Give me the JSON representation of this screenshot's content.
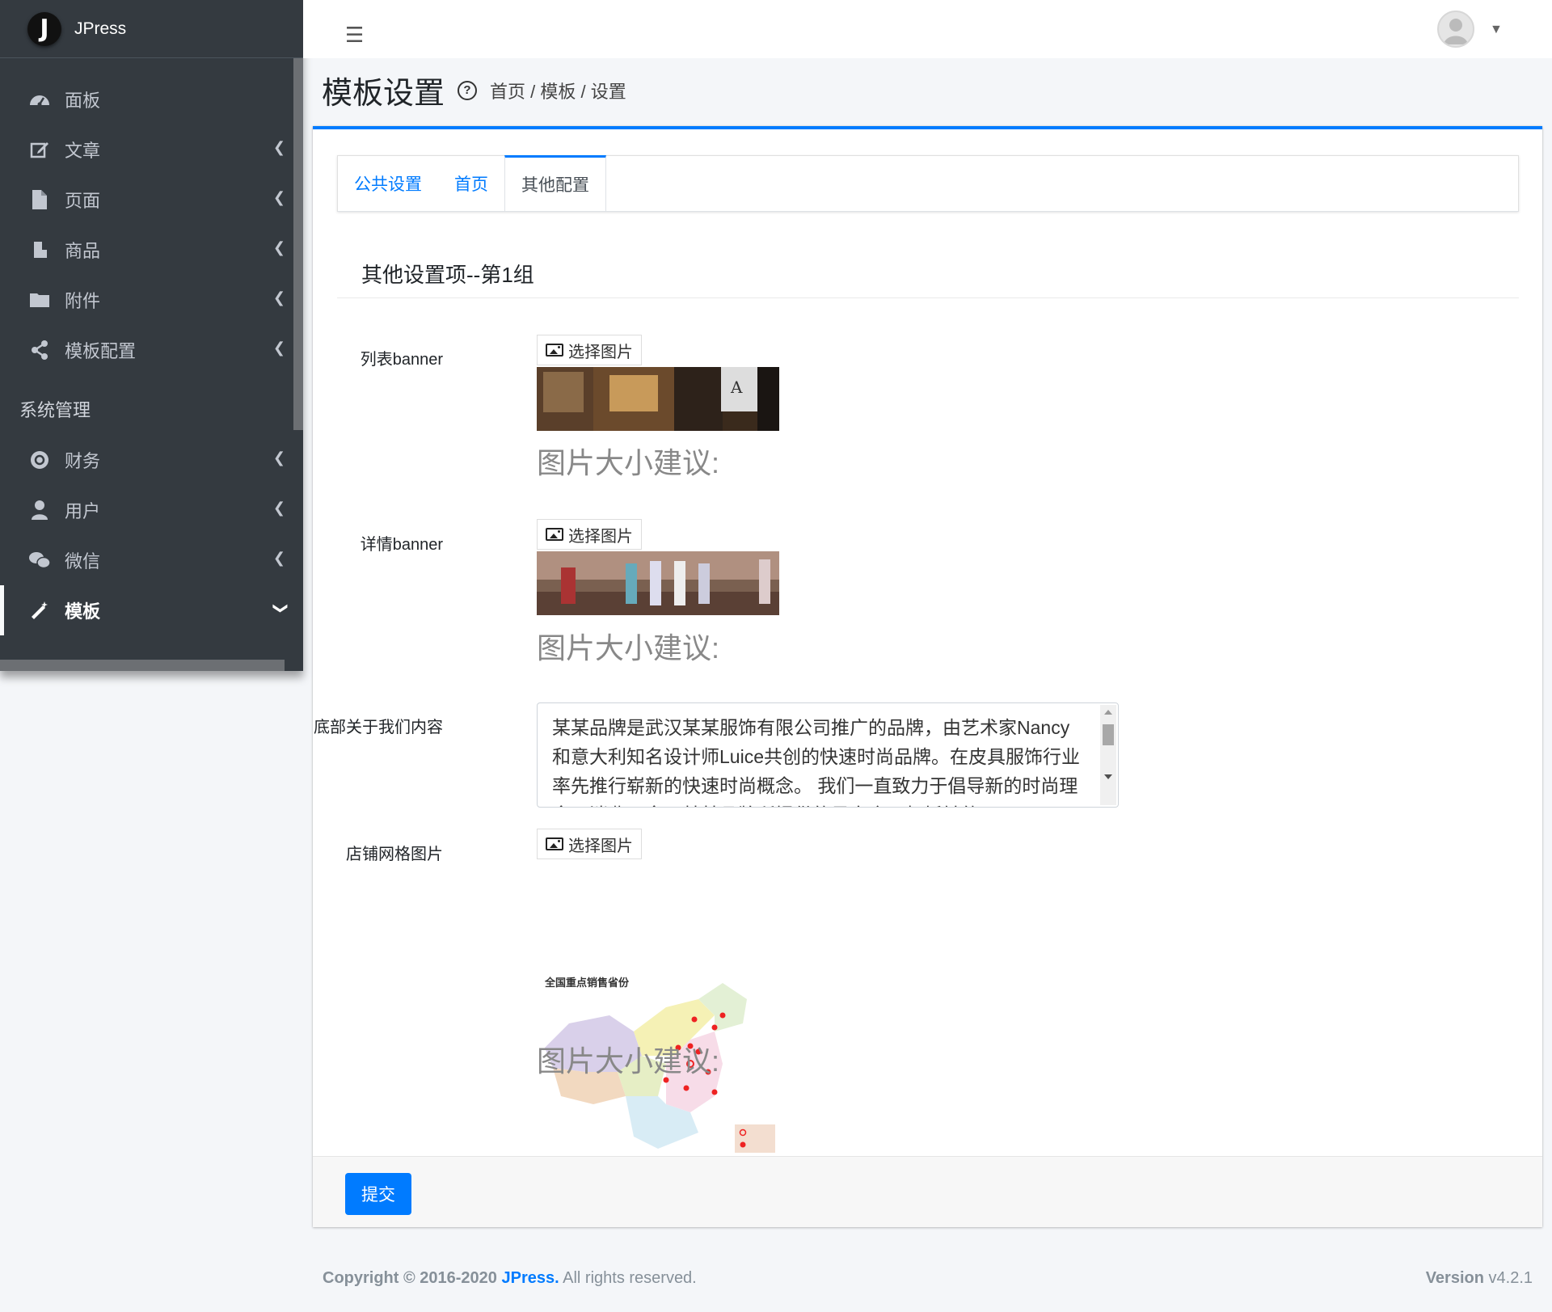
{
  "brand": {
    "logo_letter": "J",
    "name": "JPress"
  },
  "sidebar": {
    "items": [
      {
        "label": "面板",
        "icon": "dashboard-icon",
        "has_children": false
      },
      {
        "label": "文章",
        "icon": "edit-icon",
        "has_children": true
      },
      {
        "label": "页面",
        "icon": "file-icon",
        "has_children": true
      },
      {
        "label": "商品",
        "icon": "product-icon",
        "has_children": true
      },
      {
        "label": "附件",
        "icon": "folder-icon",
        "has_children": true
      },
      {
        "label": "模板配置",
        "icon": "share-icon",
        "has_children": true
      }
    ],
    "section_header": "系统管理",
    "system_items": [
      {
        "label": "财务",
        "icon": "finance-icon",
        "has_children": true
      },
      {
        "label": "用户",
        "icon": "user-icon",
        "has_children": true
      },
      {
        "label": "微信",
        "icon": "wechat-icon",
        "has_children": true
      },
      {
        "label": "模板",
        "icon": "magic-wand-icon",
        "has_children": true,
        "active": true
      }
    ]
  },
  "header": {
    "menu_icon": "hamburger-icon",
    "avatar_icon": "avatar-icon"
  },
  "page": {
    "title": "模板设置",
    "help_icon": "?",
    "breadcrumb": "首页 / 模板 / 设置"
  },
  "tabs": [
    {
      "label": "公共设置",
      "active": false
    },
    {
      "label": "首页",
      "active": false
    },
    {
      "label": "其他配置",
      "active": true
    }
  ],
  "section": {
    "title": "其他设置项--第1组"
  },
  "fields": {
    "list_banner": {
      "label": "列表banner",
      "button": "选择图片",
      "hint": "图片大小建议:"
    },
    "detail_banner": {
      "label": "详情banner",
      "button": "选择图片",
      "hint": "图片大小建议:"
    },
    "about": {
      "label": "底部关于我们内容",
      "value": "某某品牌是武汉某某服饰有限公司推广的品牌，由艺术家Nancy和意大利知名设计师Luice共创的快速时尚品牌。在皮具服饰行业率先推行崭新的快速时尚概念。 我们一直致力于倡导新的时尚理念，消费理念。某某品牌所提供的是完全不相抵触的"
    },
    "store_map": {
      "label": "店铺网格图片",
      "button": "选择图片",
      "hint": "图片大小建议:",
      "map_title": "全国重点销售省份"
    }
  },
  "submit_label": "提交",
  "footer": {
    "copyright_prefix": "Copyright © 2016-2020",
    "brand": "JPress.",
    "rights": "All rights reserved.",
    "version_label": "Version",
    "version": "v4.2.1"
  },
  "colors": {
    "accent": "#007bff",
    "sidebar_bg": "#343a40",
    "page_bg": "#f4f6f9"
  }
}
